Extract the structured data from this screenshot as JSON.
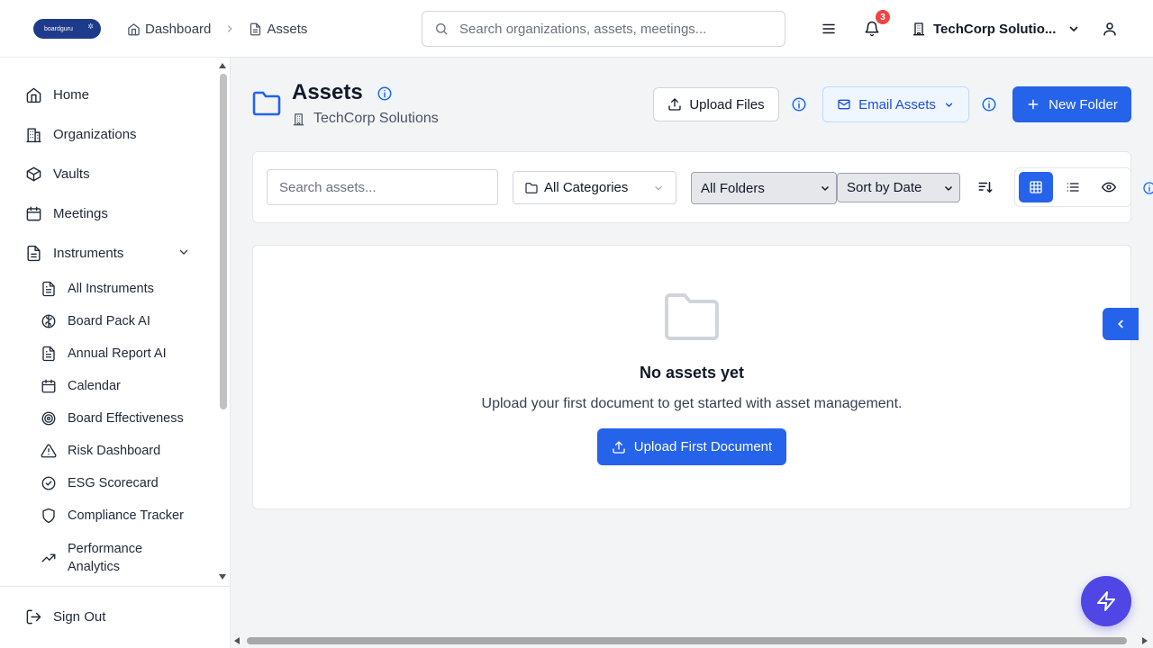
{
  "header": {
    "logo_text": "boardguru",
    "breadcrumb": [
      "Dashboard",
      "Assets"
    ],
    "search_placeholder": "Search organizations, assets, meetings...",
    "notification_count": "3",
    "org_name": "TechCorp Solutio..."
  },
  "sidebar": {
    "items": [
      {
        "label": "Home",
        "icon": "home-icon"
      },
      {
        "label": "Organizations",
        "icon": "building-icon"
      },
      {
        "label": "Vaults",
        "icon": "box-icon"
      },
      {
        "label": "Meetings",
        "icon": "calendar-icon"
      },
      {
        "label": "Instruments",
        "icon": "file-icon"
      }
    ],
    "sub_items": [
      {
        "label": "All Instruments",
        "icon": "file-text-icon"
      },
      {
        "label": "Board Pack AI",
        "icon": "brain-icon"
      },
      {
        "label": "Annual Report AI",
        "icon": "file-text-icon"
      },
      {
        "label": "Calendar",
        "icon": "calendar-icon"
      },
      {
        "label": "Board Effectiveness",
        "icon": "target-icon"
      },
      {
        "label": "Risk Dashboard",
        "icon": "alert-triangle-icon"
      },
      {
        "label": "ESG Scorecard",
        "icon": "check-circle-icon"
      },
      {
        "label": "Compliance Tracker",
        "icon": "shield-icon"
      },
      {
        "label": "Performance Analytics",
        "label_line1": "Performance",
        "label_line2": "Analytics",
        "icon": "trending-up-icon"
      }
    ],
    "sign_out": "Sign Out"
  },
  "main": {
    "title": "Assets",
    "subtitle": "TechCorp Solutions",
    "upload_files": "Upload Files",
    "email_assets": "Email Assets",
    "new_folder": "New Folder"
  },
  "filters": {
    "search_placeholder": "Search assets...",
    "category": "All Categories",
    "folder": "All Folders",
    "sort": "Sort by Date",
    "view_mode_selected": "grid"
  },
  "empty_state": {
    "title": "No assets yet",
    "text": "Upload your first document to get started with asset management.",
    "button": "Upload First Document"
  },
  "colors": {
    "primary": "#2563eb",
    "fab": "#4f46e5",
    "badge": "#ef4444"
  }
}
